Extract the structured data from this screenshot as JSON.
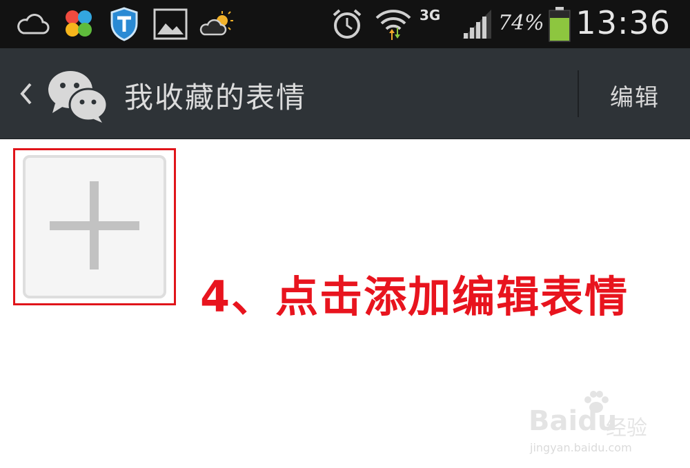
{
  "status_bar": {
    "icons": [
      "cloud-icon",
      "clover-app-icon",
      "shield-app-icon",
      "gallery-icon",
      "weather-icon",
      "alarm-icon",
      "wifi-icon",
      "signal-icon",
      "battery-icon"
    ],
    "network": "3G",
    "battery": "74%",
    "time": "13:36"
  },
  "action_bar": {
    "title": "我收藏的表情",
    "edit_label": "编辑"
  },
  "content": {
    "add_tile_icon": "plus-icon",
    "annotation": "4、点击添加编辑表情"
  },
  "watermark": {
    "brand": "Baidu",
    "cn": "经验",
    "url": "jingyan.baidu.com"
  },
  "colors": {
    "statusbar": "#121212",
    "actionbar": "#2e3337",
    "highlight": "#e0141a",
    "annotation": "#e8141e",
    "battery_fill": "#8dc63f"
  }
}
